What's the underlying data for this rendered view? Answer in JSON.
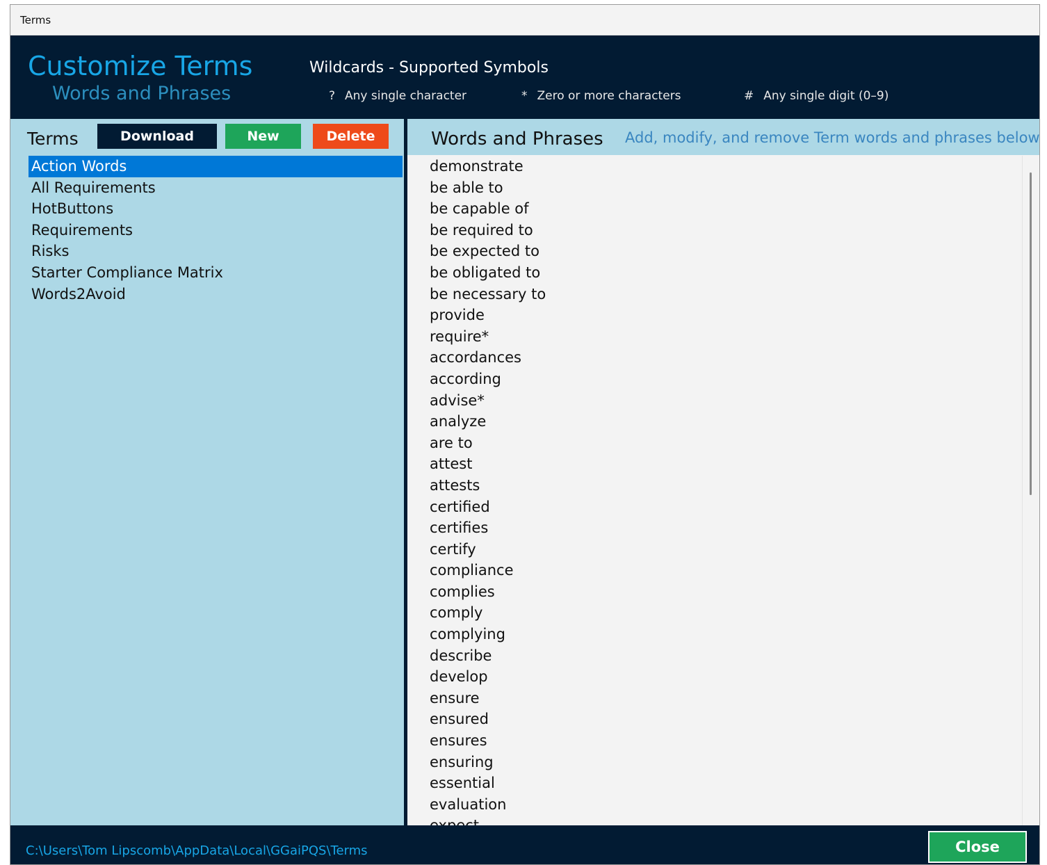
{
  "window": {
    "title": "Terms"
  },
  "header": {
    "title": "Customize Terms",
    "subtitle": "Words and Phrases",
    "wildcards": {
      "title": "Wildcards - Supported Symbols",
      "items": [
        {
          "symbol": "?",
          "text": "Any single character"
        },
        {
          "symbol": "*",
          "text": "Zero or more characters"
        },
        {
          "symbol": "#",
          "text": "Any single digit (0–9)"
        }
      ]
    }
  },
  "left": {
    "label": "Terms",
    "download_label": "Download",
    "new_label": "New",
    "delete_label": "Delete",
    "items": [
      "Action Words",
      "All Requirements",
      "HotButtons",
      "Requirements",
      "Risks",
      "Starter Compliance Matrix",
      "Words2Avoid"
    ],
    "selected": "Action Words"
  },
  "right": {
    "title": "Words and Phrases",
    "description": "Add, modify, and remove Term words and phrases below.",
    "words": [
      "demonstrate",
      "be able to",
      "be capable of",
      "be required to",
      "be expected to",
      "be obligated to",
      "be necessary to",
      "provide",
      "require*",
      "accordances",
      "according",
      "advise*",
      "analyze",
      "are to",
      "attest",
      "attests",
      "certified",
      "certifies",
      "certify",
      "compliance",
      "complies",
      "comply",
      "complying",
      "describe",
      "develop",
      "ensure",
      "ensured",
      "ensures",
      "ensuring",
      "essential",
      "evaluation",
      "expect"
    ]
  },
  "footer": {
    "path": "C:\\Users\\Tom Lipscomb\\AppData\\Local\\GGaiPQS\\Terms",
    "close_label": "Close"
  }
}
